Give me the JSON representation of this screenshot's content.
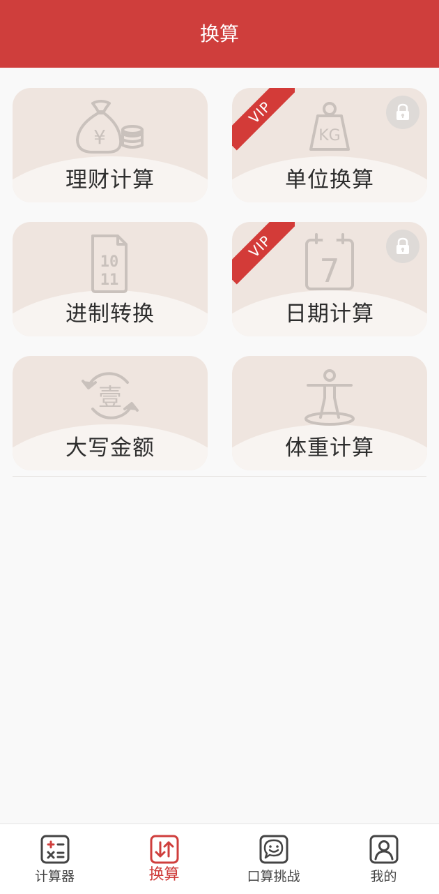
{
  "header": {
    "title": "换算"
  },
  "cards": [
    {
      "label": "理财计算",
      "icon": "money-bag-icon",
      "vip": false
    },
    {
      "label": "单位换算",
      "icon": "weight-kg-icon",
      "vip": true
    },
    {
      "label": "进制转换",
      "icon": "binary-file-icon",
      "vip": false
    },
    {
      "label": "日期计算",
      "icon": "calendar-icon",
      "vip": true
    },
    {
      "label": "大写金额",
      "icon": "chinese-numeral-icon",
      "vip": false
    },
    {
      "label": "体重计算",
      "icon": "body-figure-icon",
      "vip": false
    }
  ],
  "vip_label": "VIP",
  "icon_text": {
    "bag": "¥",
    "kg": "KG",
    "bin_top": "10",
    "bin_bottom": "11",
    "cal": "7",
    "numeral": "壹"
  },
  "tabs": [
    {
      "label": "计算器",
      "icon": "calculator-icon",
      "active": false
    },
    {
      "label": "换算",
      "icon": "convert-icon",
      "active": true
    },
    {
      "label": "口算挑战",
      "icon": "chat-smile-icon",
      "active": false
    },
    {
      "label": "我的",
      "icon": "user-icon",
      "active": false
    }
  ],
  "colors": {
    "accent": "#cf3e3c",
    "card": "#efe5df",
    "icon": "#c9c1bc"
  }
}
